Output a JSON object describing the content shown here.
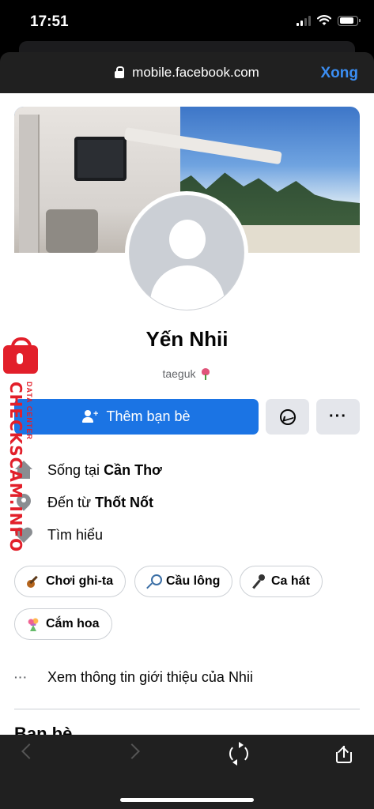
{
  "status_bar": {
    "time": "17:51"
  },
  "browser": {
    "url": "mobile.facebook.com",
    "done_label": "Xong"
  },
  "profile": {
    "name": "Yến Nhii",
    "bio": "taeguk",
    "add_friend_label": "Thêm bạn bè",
    "more_label": "···"
  },
  "info": {
    "lives_label": "Sống tại",
    "lives_value": "Cần Thơ",
    "from_label": "Đến từ",
    "from_value": "Thốt Nốt",
    "interest_label": "Tìm hiểu"
  },
  "hobbies": [
    {
      "label": "Chơi ghi-ta",
      "icon": "guitar-icon"
    },
    {
      "label": "Cầu lông",
      "icon": "badminton-icon"
    },
    {
      "label": "Ca hát",
      "icon": "microphone-icon"
    },
    {
      "label": "Cắm hoa",
      "icon": "bouquet-icon"
    }
  ],
  "see_about": {
    "dots": "···",
    "label": "Xem thông tin giới thiệu của Nhii"
  },
  "friends": {
    "heading": "Bạn bè"
  },
  "watermark": {
    "brand": "CHECKSCAM.INFO",
    "sub": "DATA CENTER"
  },
  "colors": {
    "facebook_blue": "#1b74e4",
    "safari_link": "#3b8ef3",
    "watermark_red": "#e21f2a"
  }
}
